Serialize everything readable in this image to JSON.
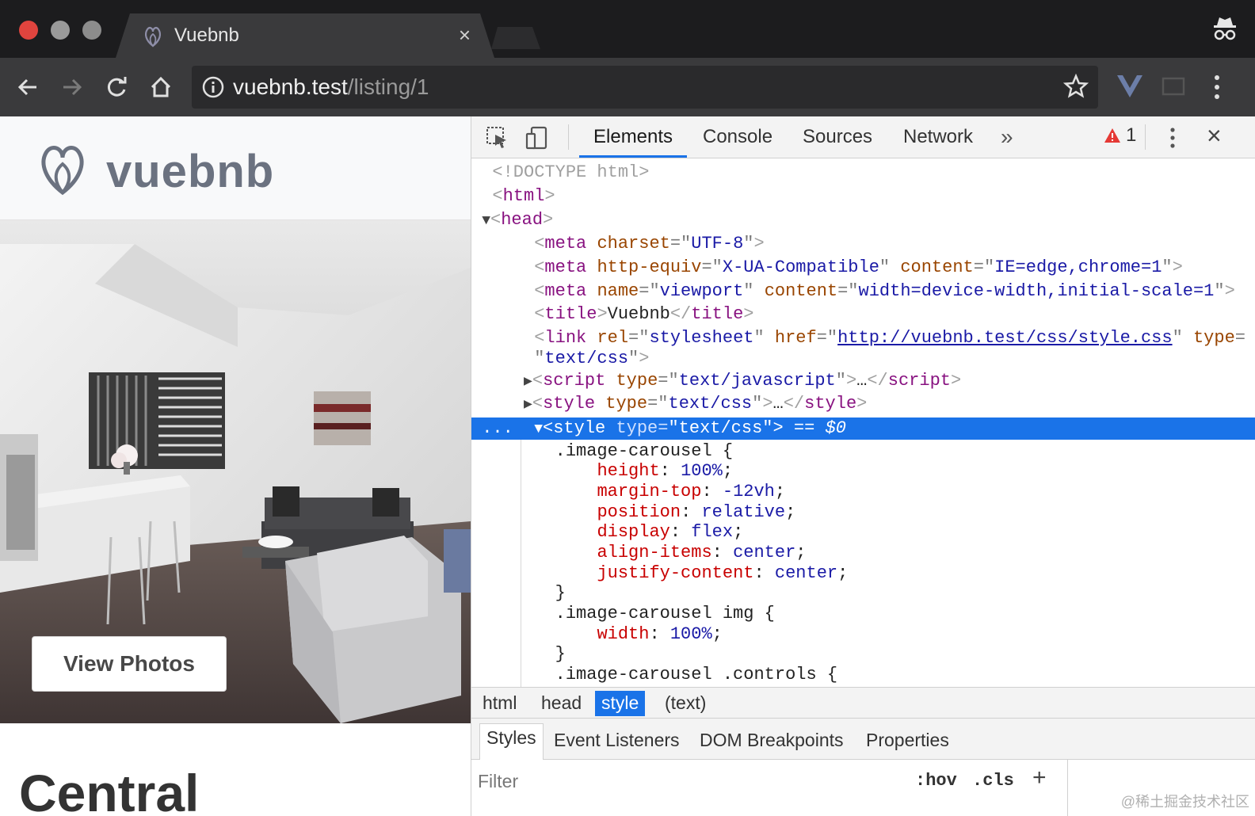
{
  "browser": {
    "tab_title": "Vuebnb",
    "url_host": "vuebnb.test",
    "url_path": "/listing/1",
    "tab_close": "×"
  },
  "page": {
    "site_name": "vuebnb",
    "view_photos_label": "View Photos",
    "listing_title": "Central"
  },
  "devtools": {
    "tabs": [
      "Elements",
      "Console",
      "Sources",
      "Network"
    ],
    "more_tabs": "»",
    "warning_count": "1",
    "close": "×",
    "breadcrumbs": [
      "html",
      "head",
      "style",
      "(text)"
    ],
    "styles_tabs": [
      "Styles",
      "Event Listeners",
      "DOM Breakpoints",
      "Properties"
    ],
    "filter_placeholder": "Filter",
    "hov_label": ":hov",
    "cls_label": ".cls",
    "plus_label": "+",
    "selected_marker": "...",
    "dollar_ref": "== $0",
    "watermark": "@稀土掘金技术社区"
  },
  "colors": {
    "selection_blue": "#1a73e8",
    "tag_purple": "#881280",
    "attr_brown": "#994500",
    "value_blue": "#1a1aa6",
    "css_prop_red": "#c80000"
  }
}
